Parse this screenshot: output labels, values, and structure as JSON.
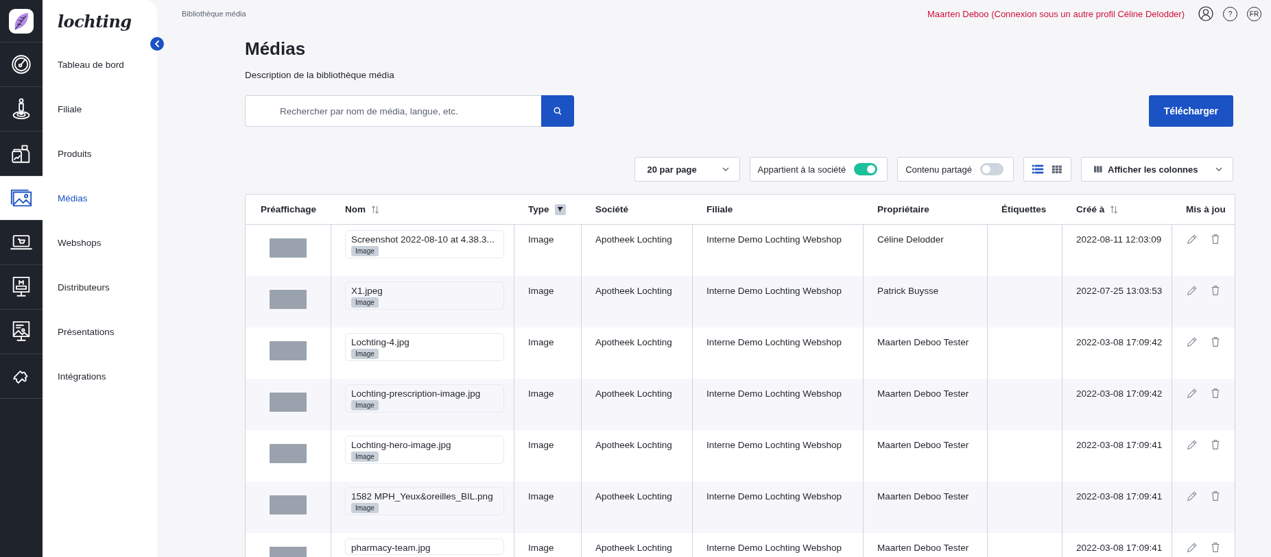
{
  "brand": {
    "wordmark": "lochting"
  },
  "nav": [
    {
      "label": "Tableau de bord",
      "kind": "gauge",
      "selected": false
    },
    {
      "label": "Filiale",
      "kind": "person",
      "selected": false
    },
    {
      "label": "Produits",
      "kind": "bottles",
      "selected": false
    },
    {
      "label": "Médias",
      "kind": "images",
      "selected": true
    },
    {
      "label": "Webshops",
      "kind": "laptop",
      "selected": false
    },
    {
      "label": "Distributeurs",
      "kind": "monitor",
      "selected": false
    },
    {
      "label": "Présentations",
      "kind": "presentation",
      "selected": false
    },
    {
      "label": "Intégrations",
      "kind": "puzzle",
      "selected": false
    }
  ],
  "breadcrumb": "Bibliothèque média",
  "user": {
    "text": "Maarten Deboo (Connexion sous un autre profil Céline Delodder)",
    "help": "?",
    "language": "FR"
  },
  "page": {
    "title": "Médias",
    "description": "Description de la bibliothèque média",
    "search": {
      "placeholder": "Rechercher par nom de média, langue, etc."
    },
    "upload_button": "Télécharger"
  },
  "toolbar": {
    "per_page": "20 par page",
    "toggles": [
      {
        "label": "Appartient à la société",
        "on": true
      },
      {
        "label": "Contenu partagé",
        "on": false
      }
    ],
    "view_modes": [
      {
        "kind": "list",
        "selected": true
      },
      {
        "kind": "grid",
        "selected": false
      }
    ],
    "columns_button": "Afficher les colonnes"
  },
  "table": {
    "columns": [
      {
        "label": "Préaffichage",
        "kind": "plain"
      },
      {
        "label": "Nom",
        "kind": "sort"
      },
      {
        "label": "Type",
        "kind": "filter"
      },
      {
        "label": "Société",
        "kind": "plain"
      },
      {
        "label": "Filiale",
        "kind": "plain"
      },
      {
        "label": "Propriétaire",
        "kind": "plain"
      },
      {
        "label": "Étiquettes",
        "kind": "plain"
      },
      {
        "label": "Créé à",
        "kind": "sort"
      },
      {
        "label": "Mis à jou",
        "kind": "plain"
      }
    ],
    "rows": [
      {
        "name": "Screenshot 2022-08-10 at 4.38.3...",
        "badge": "Image",
        "type": "Image",
        "company": "Apotheek Lochting",
        "branch": "Interne Demo Lochting Webshop",
        "owner": "Céline Delodder",
        "created": "2022-08-11 12:03:09"
      },
      {
        "name": "X1.jpeg",
        "badge": "Image",
        "type": "Image",
        "company": "Apotheek Lochting",
        "branch": "Interne Demo Lochting Webshop",
        "owner": "Patrick Buysse",
        "created": "2022-07-25 13:03:53"
      },
      {
        "name": "Lochting-4.jpg",
        "badge": "Image",
        "type": "Image",
        "company": "Apotheek Lochting",
        "branch": "Interne Demo Lochting Webshop",
        "owner": "Maarten Deboo Tester",
        "created": "2022-03-08 17:09:42"
      },
      {
        "name": "Lochting-prescription-image.jpg",
        "badge": "Image",
        "type": "Image",
        "company": "Apotheek Lochting",
        "branch": "Interne Demo Lochting Webshop",
        "owner": "Maarten Deboo Tester",
        "created": "2022-03-08 17:09:42"
      },
      {
        "name": "Lochting-hero-image.jpg",
        "badge": "Image",
        "type": "Image",
        "company": "Apotheek Lochting",
        "branch": "Interne Demo Lochting Webshop",
        "owner": "Maarten Deboo Tester",
        "created": "2022-03-08 17:09:41"
      },
      {
        "name": "1582 MPH_Yeux&oreilles_BIL.png",
        "badge": "Image",
        "type": "Image",
        "company": "Apotheek Lochting",
        "branch": "Interne Demo Lochting Webshop",
        "owner": "Maarten Deboo Tester",
        "created": "2022-03-08 17:09:41"
      },
      {
        "name": "pharmacy-team.jpg",
        "type": "Image",
        "company": "Apotheek Lochting",
        "branch": "Interne Demo Lochting Webshop",
        "owner": "Maarten Deboo Tester",
        "created": "2022-03-08 17:09:41"
      }
    ]
  }
}
